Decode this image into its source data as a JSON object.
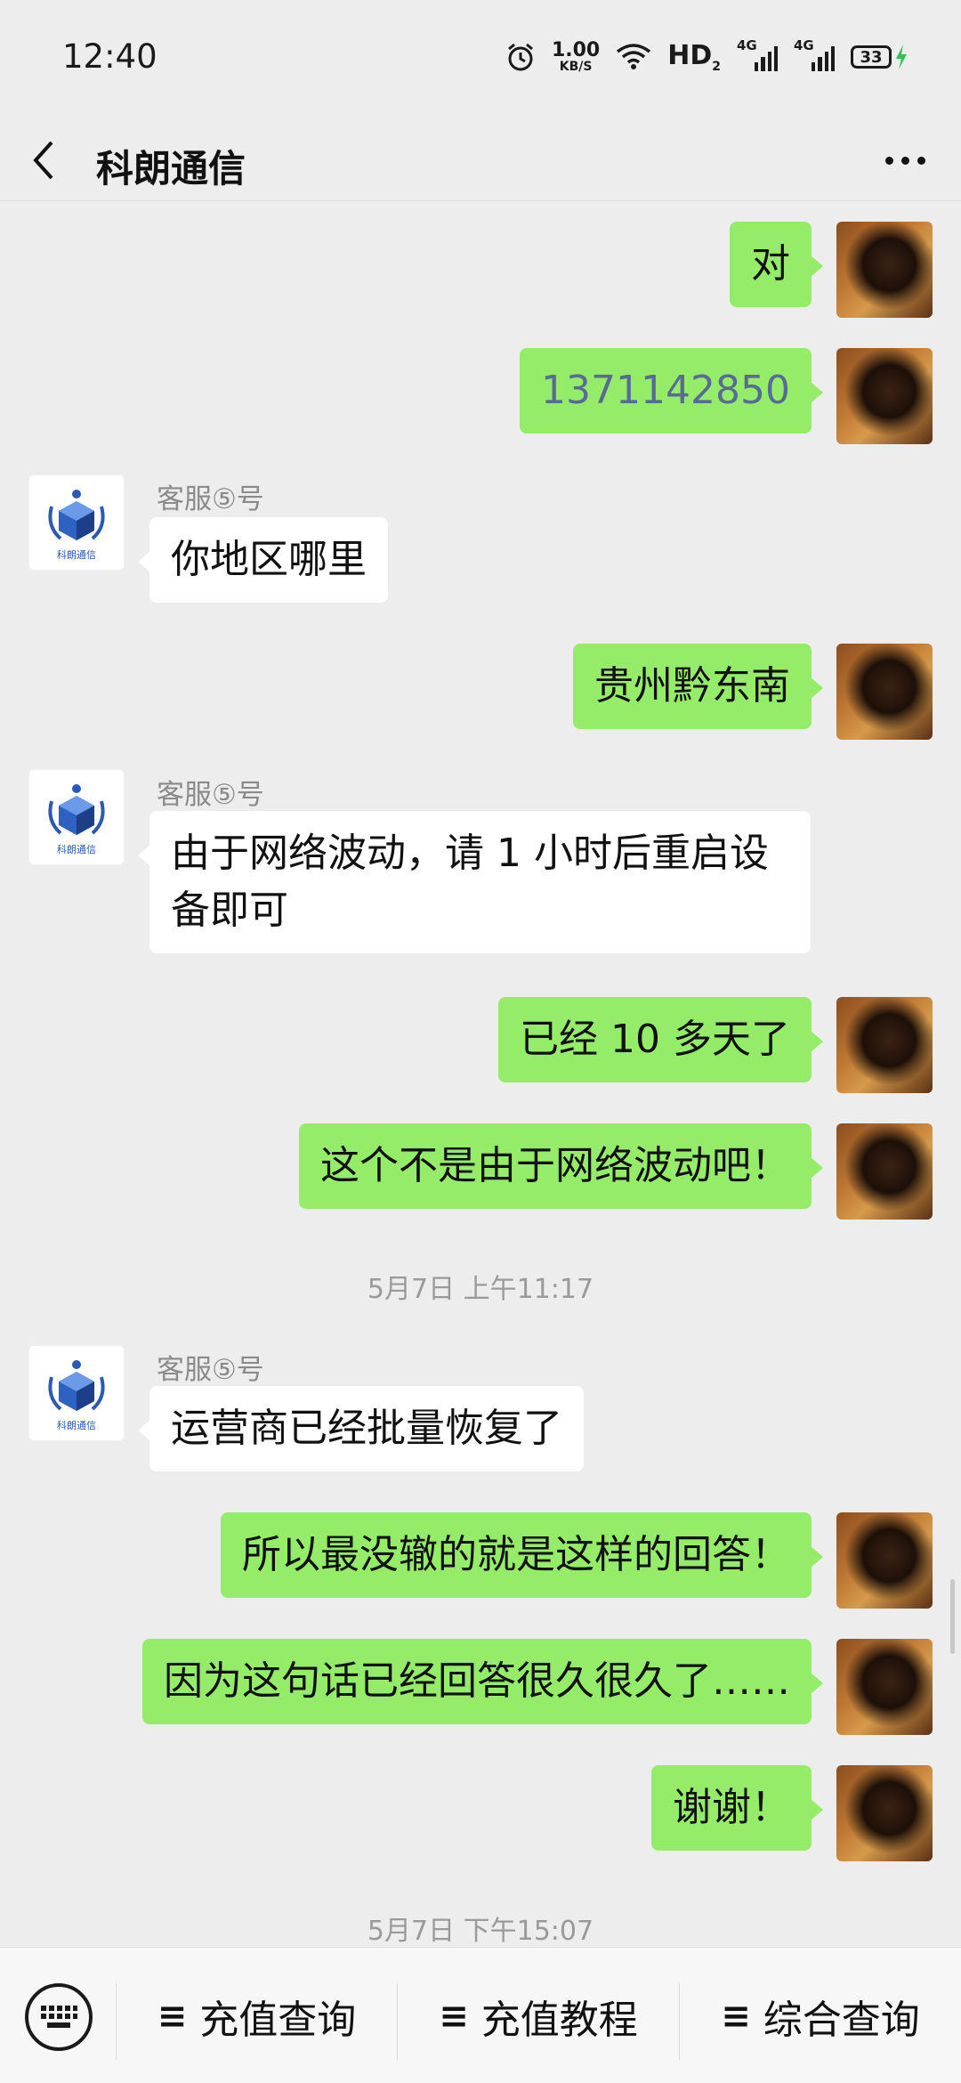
{
  "status_bar": {
    "time": "12:40",
    "speed_value": "1.00",
    "speed_unit": "KB/S",
    "hd_label": "HD",
    "hd_sub": "2",
    "signal1_label": "4G",
    "signal2_label": "4G",
    "battery": "33",
    "icons": [
      "alarm-icon",
      "wifi-icon",
      "signal-icon",
      "battery-icon",
      "charging-icon"
    ]
  },
  "header": {
    "title": "科朗通信",
    "back_icon": "chevron-left-icon",
    "more_icon": "more-dots-icon"
  },
  "chat": {
    "service_name": "客服⑤号",
    "messages": [
      {
        "side": "out",
        "text": "对"
      },
      {
        "side": "out",
        "text": "1371142850"
      },
      {
        "side": "in",
        "sender": "客服⑤号",
        "text": "你地区哪里"
      },
      {
        "side": "out",
        "text": "贵州黔东南"
      },
      {
        "side": "in",
        "sender": "客服⑤号",
        "text": "由于网络波动，请 1 小时后重启设备即可"
      },
      {
        "side": "out",
        "text": "已经 10 多天了"
      },
      {
        "side": "out",
        "text": "这个不是由于网络波动吧！"
      },
      {
        "type": "time",
        "text": "5月7日 上午11:17"
      },
      {
        "side": "in",
        "sender": "客服⑤号",
        "text": "运营商已经批量恢复了"
      },
      {
        "side": "out",
        "text": "所以最没辙的就是这样的回答！"
      },
      {
        "side": "out",
        "text": "因为这句话已经回答很久很久了……"
      },
      {
        "side": "out",
        "text": "谢谢！"
      },
      {
        "type": "time",
        "text": "5月7日 下午15:07"
      }
    ],
    "logo_text": "科朗通信"
  },
  "bottom_menu": {
    "keyboard_icon": "keyboard-icon",
    "items": [
      {
        "icon": "≡",
        "label": "充值查询"
      },
      {
        "icon": "≡",
        "label": "充值教程"
      },
      {
        "icon": "≡",
        "label": "综合查询"
      }
    ]
  },
  "colors": {
    "background": "#ededed",
    "outgoing_bubble": "#95ec69",
    "incoming_bubble": "#ffffff",
    "phone_link": "#576b95"
  }
}
